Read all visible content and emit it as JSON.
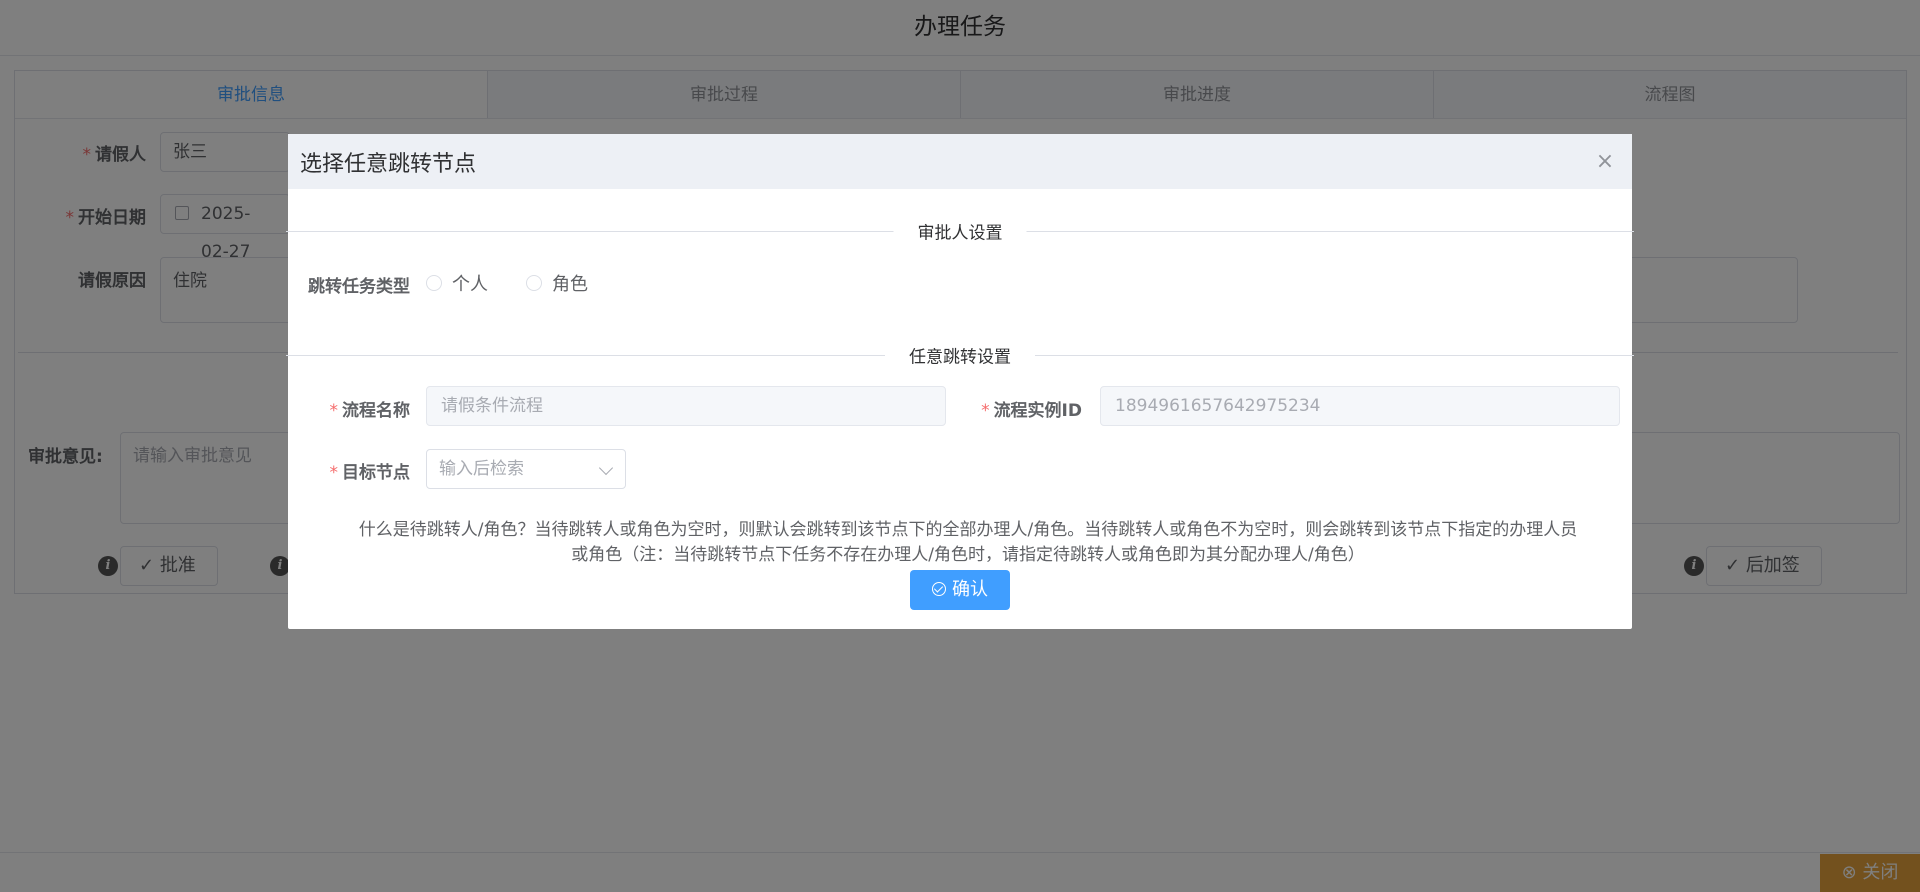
{
  "page": {
    "title": "办理任务"
  },
  "tabs": [
    {
      "label": "审批信息"
    },
    {
      "label": "审批过程"
    },
    {
      "label": "审批进度"
    },
    {
      "label": "流程图"
    }
  ],
  "form": {
    "applicant_label": "请假人",
    "applicant_value": "张三",
    "start_date_label": "开始日期",
    "start_date_value": "2025-02-27",
    "reason_label": "请假原因",
    "reason_value": "住院",
    "opinion_label": "审批意见:",
    "opinion_placeholder": "请输入审批意见",
    "approve_label": "批准",
    "add_sign_label": "后加签",
    "close_label": "关闭",
    "required_mark": "*"
  },
  "dialog": {
    "title": "选择任意跳转节点",
    "close_icon": "×",
    "section_approver": "审批人设置",
    "jump_type_label": "跳转任务类型",
    "radio_personal": "个人",
    "radio_role": "角色",
    "section_jump": "任意跳转设置",
    "process_name_label": "流程名称",
    "process_name_placeholder": "请假条件流程",
    "instance_id_label": "流程实例ID",
    "instance_id_value": "1894961657642975234",
    "target_node_label": "目标节点",
    "target_node_placeholder": "输入后检索",
    "tip_line1": "什么是待跳转人/角色？当待跳转人或角色为空时，则默认会跳转到该节点下的全部办理人/角色。当待跳转人或角色不为空时，则会跳转到该节点下指定的办理人员",
    "tip_line2": "或角色（注：当待跳转节点下任务不存在办理人/角色时，请指定待跳转人或角色即为其分配办理人/角色）",
    "confirm_label": "确认",
    "required_mark": "*"
  }
}
